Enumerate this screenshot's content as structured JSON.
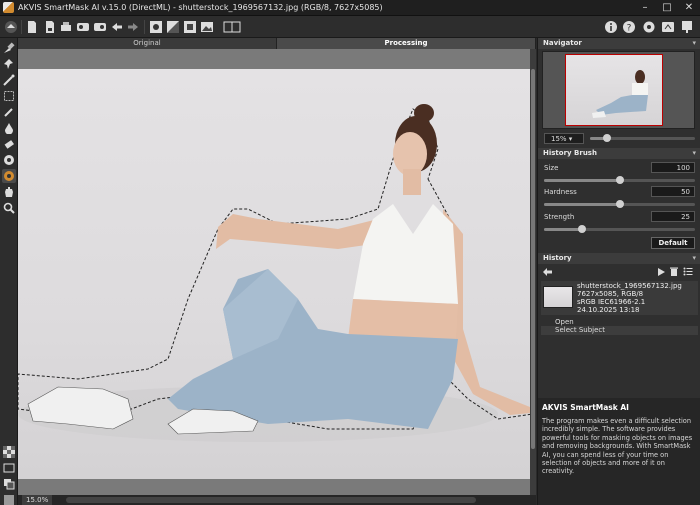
{
  "window": {
    "title": "AKVIS SmartMask AI v.15.0 (DirectML) - shutterstock_1969567132.jpg (RGB/8, 7627x5085)",
    "minimize": "–",
    "maximize": "□",
    "close": "✕"
  },
  "tabs": [
    {
      "label": "Original",
      "active": false
    },
    {
      "label": "Processing",
      "active": true
    }
  ],
  "status": {
    "zoom": "15.0%"
  },
  "navigator": {
    "header": "Navigator",
    "zoom_value": "15%",
    "zoom_slider_fraction": 0.15
  },
  "history_brush": {
    "header": "History Brush",
    "size_label": "Size",
    "size_value": "100",
    "hardness_label": "Hardness",
    "hardness_value": "50",
    "strength_label": "Strength",
    "strength_value": "25",
    "default_label": "Default"
  },
  "history": {
    "header": "History",
    "file_name": "shutterstock_1969567132.jpg",
    "file_info": "7627x5085, RGB/8",
    "color_profile": "sRGB IEC61966-2.1",
    "date": "24.10.2025 13:18",
    "items": [
      "Open",
      "Select Subject"
    ]
  },
  "about": {
    "title": "AKVIS SmartMask AI",
    "text": "The program makes even a difficult selection incredibly simple. The software provides powerful tools for masking objects on images and removing backgrounds. With SmartMask AI, you can spend less of your time on selection of objects and more of it on creativity."
  },
  "colors": {
    "accent": "#d28b2f",
    "panel_bg": "#2f2f2f",
    "canvas_bg": "#7a7a7a"
  }
}
